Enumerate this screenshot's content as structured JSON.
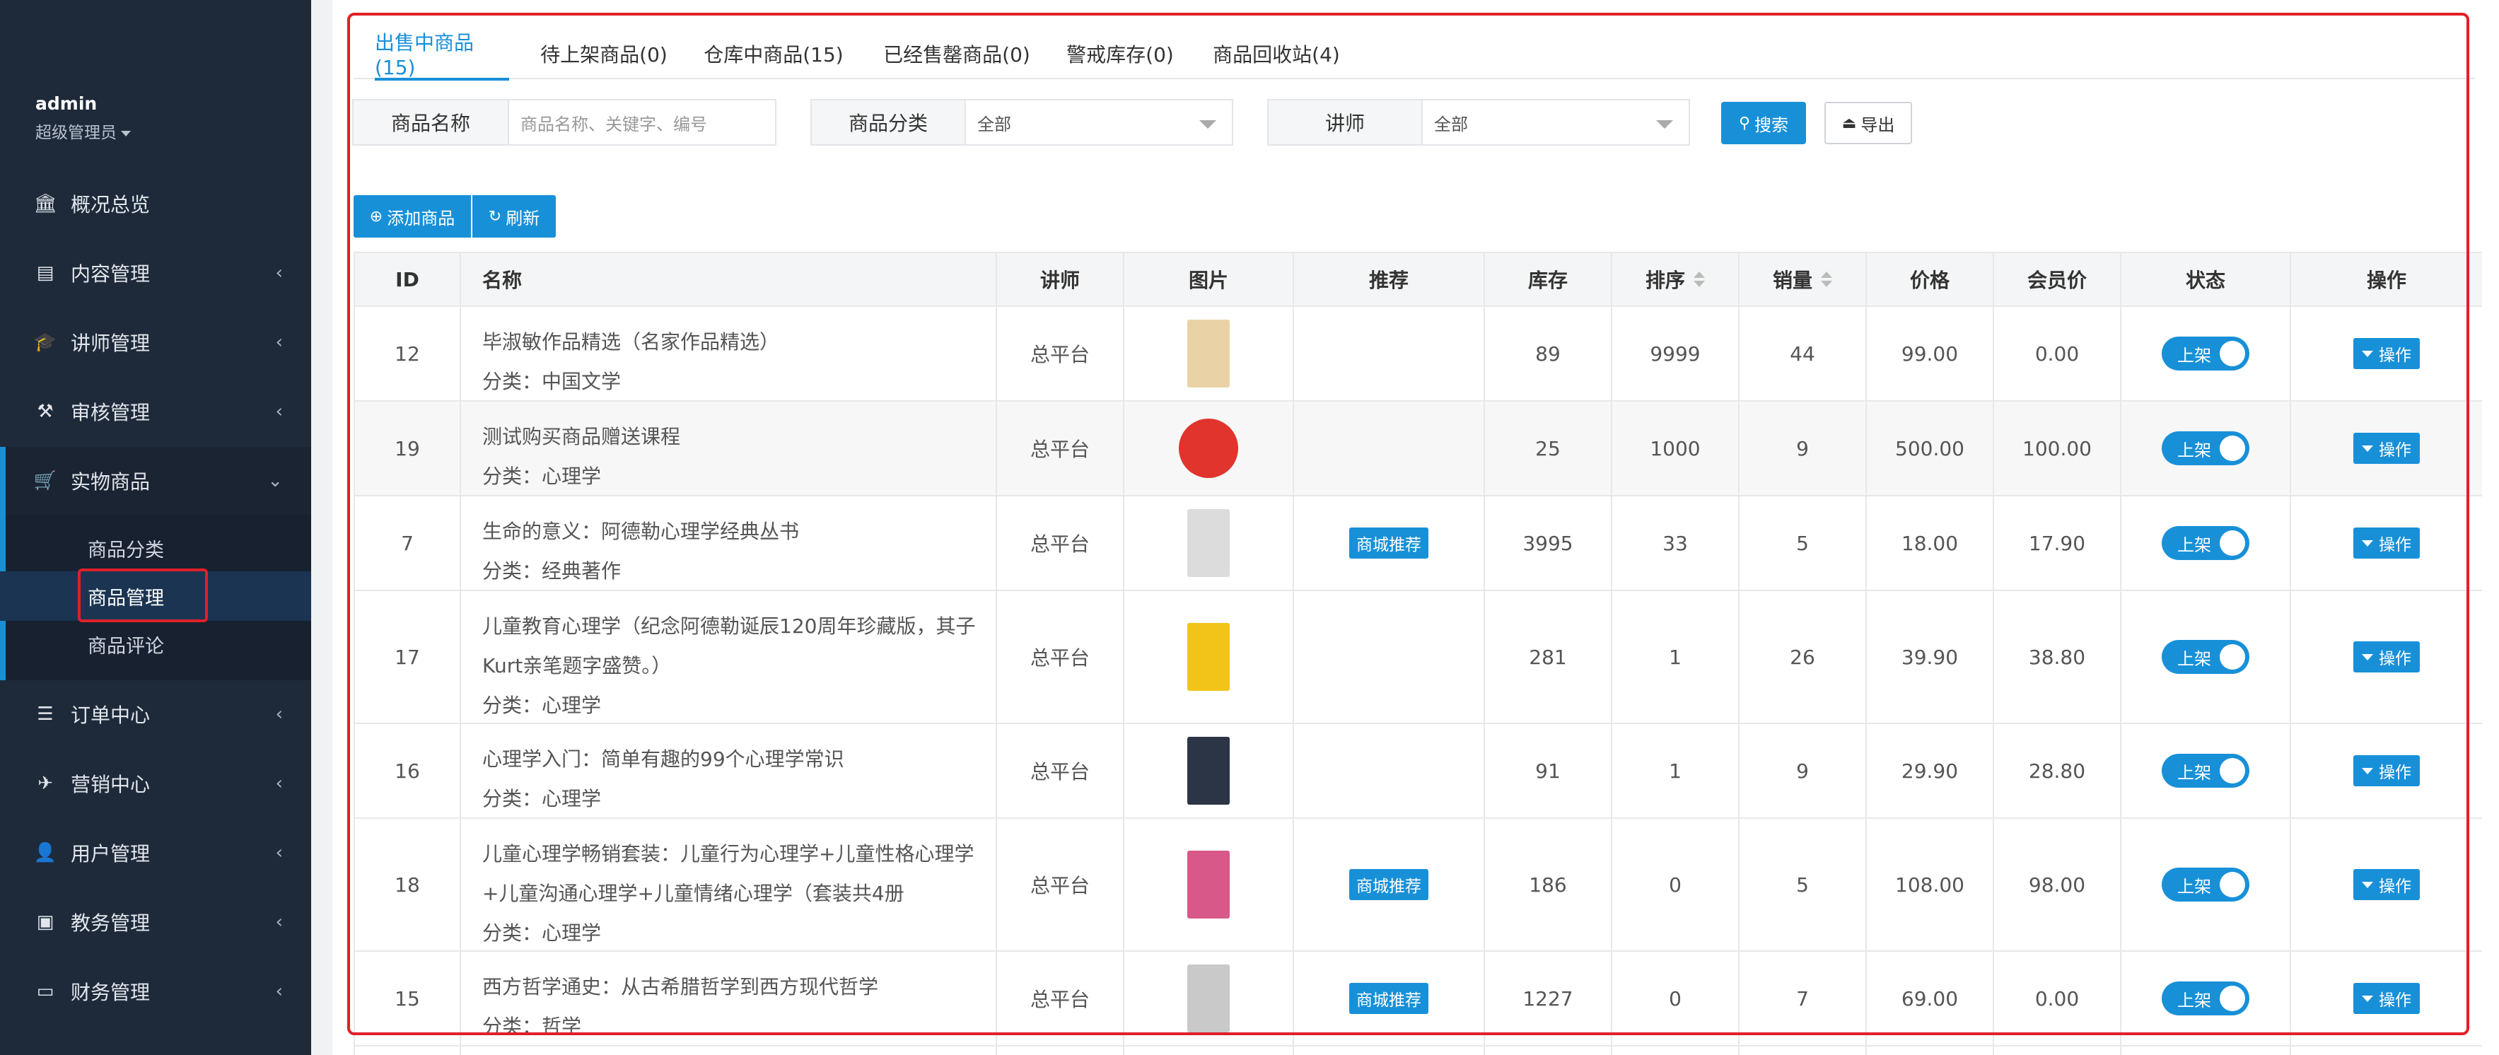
{
  "sidebar": {
    "user_name": "admin",
    "user_role": "超级管理员",
    "items": [
      {
        "label": "概况总览",
        "icon": "bank-icon",
        "glyph": "🏛",
        "chevron": ""
      },
      {
        "label": "内容管理",
        "icon": "newspaper-icon",
        "glyph": "▤",
        "chevron": "‹"
      },
      {
        "label": "讲师管理",
        "icon": "graduation-cap-icon",
        "glyph": "🎓",
        "chevron": "‹"
      },
      {
        "label": "审核管理",
        "icon": "gavel-icon",
        "glyph": "⚒",
        "chevron": "‹"
      },
      {
        "label": "实物商品",
        "icon": "cart-icon",
        "glyph": "🛒",
        "chevron": "⌄"
      },
      {
        "label": "订单中心",
        "icon": "list-icon",
        "glyph": "☰",
        "chevron": "‹"
      },
      {
        "label": "营销中心",
        "icon": "paper-plane-icon",
        "glyph": "✈",
        "chevron": "‹"
      },
      {
        "label": "用户管理",
        "icon": "user-icon",
        "glyph": "👤",
        "chevron": "‹"
      },
      {
        "label": "教务管理",
        "icon": "book-icon",
        "glyph": "▣",
        "chevron": "‹"
      },
      {
        "label": "财务管理",
        "icon": "money-icon",
        "glyph": "▭",
        "chevron": "‹"
      }
    ],
    "sub_items": [
      {
        "label": "商品分类"
      },
      {
        "label": "商品管理"
      },
      {
        "label": "商品评论"
      }
    ]
  },
  "tabs": [
    {
      "label": "出售中商品(15)"
    },
    {
      "label": "待上架商品(0)"
    },
    {
      "label": "仓库中商品(15)"
    },
    {
      "label": "已经售罄商品(0)"
    },
    {
      "label": "警戒库存(0)"
    },
    {
      "label": "商品回收站(4)"
    }
  ],
  "filters": {
    "name_label": "商品名称",
    "name_placeholder": "商品名称、关键字、编号",
    "category_label": "商品分类",
    "category_value": "全部",
    "teacher_label": "讲师",
    "teacher_value": "全部",
    "search_label": "搜索",
    "export_label": "导出"
  },
  "actions": {
    "add_label": "添加商品",
    "refresh_label": "刷新"
  },
  "table": {
    "headers": [
      "ID",
      "名称",
      "讲师",
      "图片",
      "推荐",
      "库存",
      "排序",
      "销量",
      "价格",
      "会员价",
      "状态",
      "操作"
    ],
    "category_prefix": "分类：",
    "status_label": "上架",
    "op_label": "操作",
    "rows": [
      {
        "id": "12",
        "name": "毕淑敏作品精选（名家作品精选）",
        "category": "中国文学",
        "teacher": "总平台",
        "thumb": "#e9d3a6",
        "recommend": "",
        "stock": "89",
        "sort": "9999",
        "sales": "44",
        "price": "99.00",
        "member_price": "0.00"
      },
      {
        "id": "19",
        "name": "测试购买商品赠送课程",
        "category": "心理学",
        "teacher": "总平台",
        "thumb": "#e0342c",
        "recommend": "",
        "stock": "25",
        "sort": "1000",
        "sales": "9",
        "price": "500.00",
        "member_price": "100.00"
      },
      {
        "id": "7",
        "name": "生命的意义：阿德勒心理学经典丛书",
        "category": "经典著作",
        "teacher": "总平台",
        "thumb": "#dcdcdc",
        "recommend": "商城推荐",
        "stock": "3995",
        "sort": "33",
        "sales": "5",
        "price": "18.00",
        "member_price": "17.90"
      },
      {
        "id": "17",
        "name": "儿童教育心理学（纪念阿德勒诞辰120周年珍藏版，其子Kurt亲笔题字盛赞。）",
        "category": "心理学",
        "teacher": "总平台",
        "thumb": "#f2c419",
        "recommend": "",
        "stock": "281",
        "sort": "1",
        "sales": "26",
        "price": "39.90",
        "member_price": "38.80"
      },
      {
        "id": "16",
        "name": "心理学入门：简单有趣的99个心理学常识",
        "category": "心理学",
        "teacher": "总平台",
        "thumb": "#2b3545",
        "recommend": "",
        "stock": "91",
        "sort": "1",
        "sales": "9",
        "price": "29.90",
        "member_price": "28.80"
      },
      {
        "id": "18",
        "name": "儿童心理学畅销套装：儿童行为心理学+儿童性格心理学+儿童沟通心理学+儿童情绪心理学（套装共4册",
        "category": "心理学",
        "teacher": "总平台",
        "thumb": "#d9588a",
        "recommend": "商城推荐",
        "stock": "186",
        "sort": "0",
        "sales": "5",
        "price": "108.00",
        "member_price": "98.00"
      },
      {
        "id": "15",
        "name": "西方哲学通史：从古希腊哲学到西方现代哲学",
        "category": "哲学",
        "teacher": "总平台",
        "thumb": "#c9c9c9",
        "recommend": "商城推荐",
        "stock": "1227",
        "sort": "0",
        "sales": "7",
        "price": "69.00",
        "member_price": "0.00"
      }
    ]
  },
  "colors": {
    "primary": "#1890d8",
    "sidebar_bg": "#1e2a3a",
    "highlight_red": "#e0202a"
  }
}
